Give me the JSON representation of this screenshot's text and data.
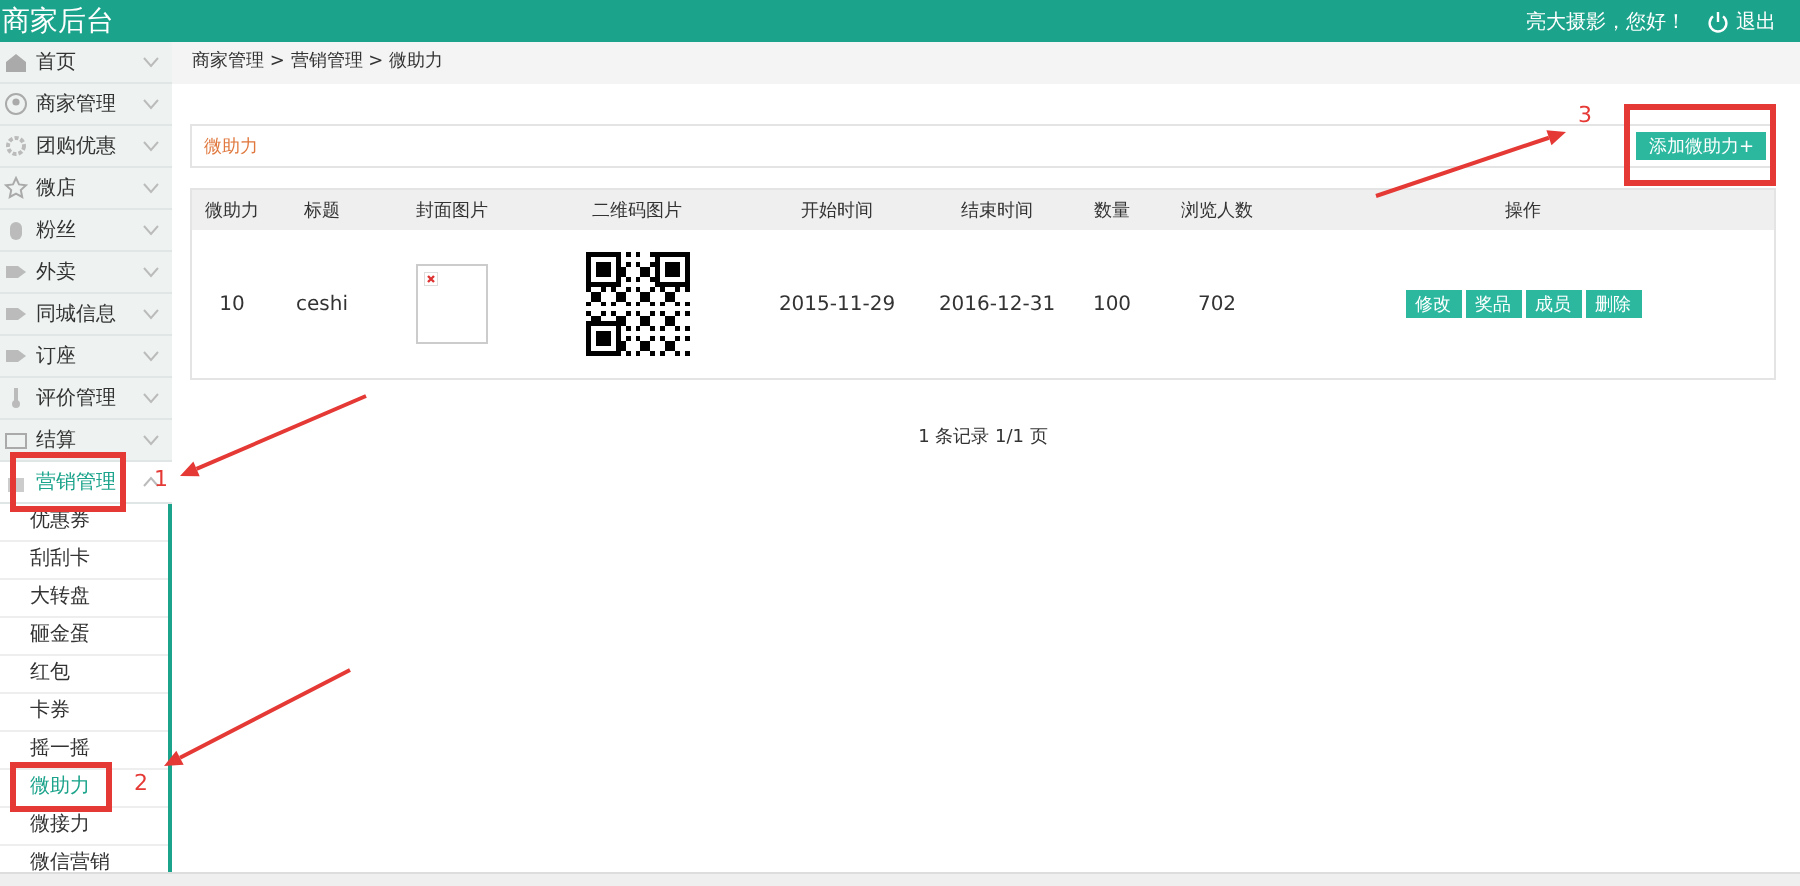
{
  "header": {
    "title": "商家后台",
    "greeting": "亮大摄影，您好！",
    "logout": "退出"
  },
  "sidebar": {
    "items": [
      {
        "label": "首页",
        "selected": false,
        "expanded": false
      },
      {
        "label": "商家管理",
        "selected": false,
        "expanded": false
      },
      {
        "label": "团购优惠",
        "selected": false,
        "expanded": false
      },
      {
        "label": "微店",
        "selected": false,
        "expanded": false
      },
      {
        "label": "粉丝",
        "selected": false,
        "expanded": false
      },
      {
        "label": "外卖",
        "selected": false,
        "expanded": false
      },
      {
        "label": "同城信息",
        "selected": false,
        "expanded": false
      },
      {
        "label": "订座",
        "selected": false,
        "expanded": false
      },
      {
        "label": "评价管理",
        "selected": false,
        "expanded": false
      },
      {
        "label": "结算",
        "selected": false,
        "expanded": false
      },
      {
        "label": "营销管理",
        "selected": true,
        "expanded": true,
        "children": [
          {
            "label": "优惠券",
            "selected": false
          },
          {
            "label": "刮刮卡",
            "selected": false
          },
          {
            "label": "大转盘",
            "selected": false
          },
          {
            "label": "砸金蛋",
            "selected": false
          },
          {
            "label": "红包",
            "selected": false
          },
          {
            "label": "卡券",
            "selected": false
          },
          {
            "label": "摇一摇",
            "selected": false
          },
          {
            "label": "微助力",
            "selected": true
          },
          {
            "label": "微接力",
            "selected": false
          },
          {
            "label": "微信营销",
            "selected": false
          }
        ]
      }
    ]
  },
  "breadcrumb": "商家管理 > 营销管理 > 微助力",
  "panel": {
    "title": "微助力",
    "add_button": "添加微助力+"
  },
  "table": {
    "columns": [
      "微助力",
      "标题",
      "封面图片",
      "二维码图片",
      "开始时间",
      "结束时间",
      "数量",
      "浏览人数",
      "操作"
    ],
    "rows": [
      {
        "cells": [
          "10",
          "ceshi",
          "",
          "",
          "2015-11-29",
          "2016-12-31",
          "100",
          "702"
        ],
        "actions": [
          "修改",
          "奖品",
          "成员",
          "删除"
        ]
      }
    ]
  },
  "pagination": "1 条记录 1/1 页",
  "annotations": [
    {
      "label": "1"
    },
    {
      "label": "2"
    },
    {
      "label": "3"
    }
  ]
}
